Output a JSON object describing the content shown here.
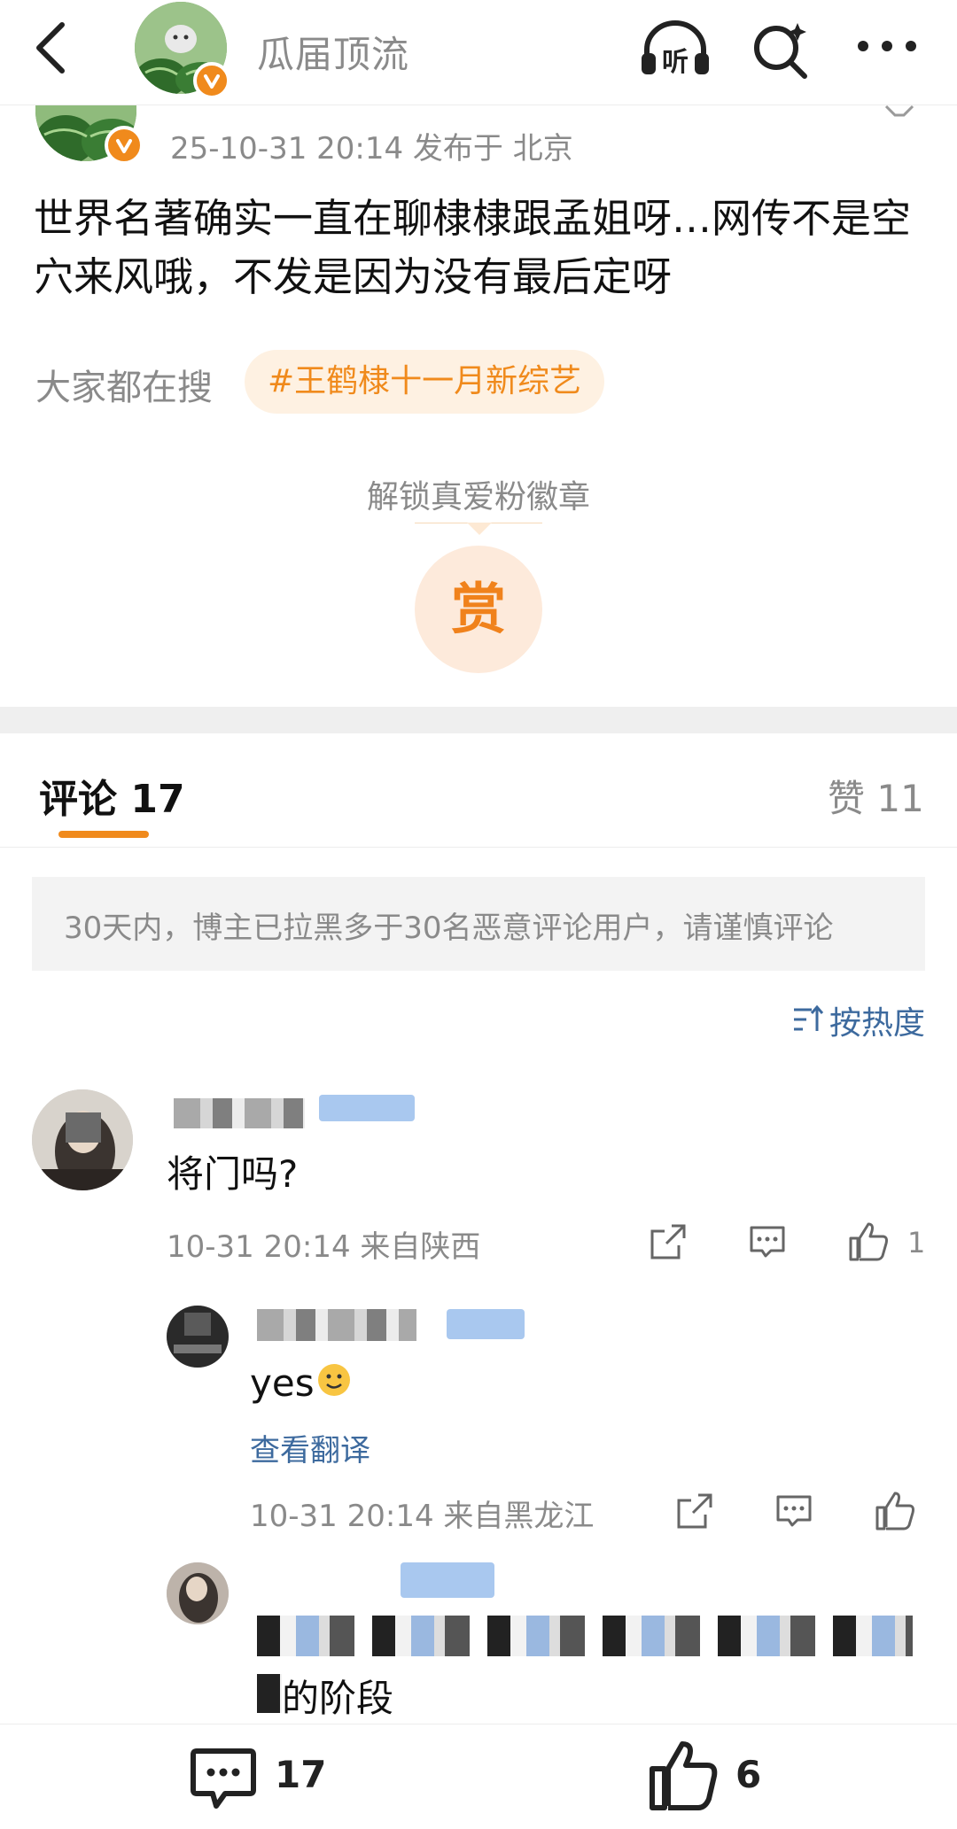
{
  "header": {
    "title": "瓜届顶流",
    "icons": [
      "back-icon",
      "listen-icon",
      "search-icon",
      "more-icon"
    ],
    "listen_label": "听"
  },
  "post": {
    "meta": "25-10-31 20:14  发布于 北京",
    "body": "世界名著确实一直在聊棣棣跟孟姐呀…网传不是空穴来风哦，不发是因为没有最后定呀",
    "search_label": "大家都在搜",
    "topic": "#王鹤棣十一月新综艺",
    "unlock_label": "解锁真爱粉徽章",
    "reward_label": "赏"
  },
  "tabs": {
    "comments_label": "评论",
    "comments_count": "17",
    "likes_label": "赞",
    "likes_count": "11"
  },
  "notice": "30天内，博主已拉黑多于30名恶意评论用户，请谨慎评论",
  "sort_label": "按热度",
  "comments": [
    {
      "text": "将门吗?",
      "meta": "10-31 20:14  来自陕西",
      "like_count": "1"
    }
  ],
  "replies": [
    {
      "text": "yes",
      "translate": "查看翻译",
      "meta": "10-31 20:14  来自黑龙江"
    },
    {
      "text_tail": "的阶段"
    }
  ],
  "bottom_bar": {
    "comment_count": "17",
    "like_count": "6"
  },
  "colors": {
    "accent": "#f08a1c",
    "link": "#3d6a9e",
    "muted": "#8a8a8a"
  }
}
